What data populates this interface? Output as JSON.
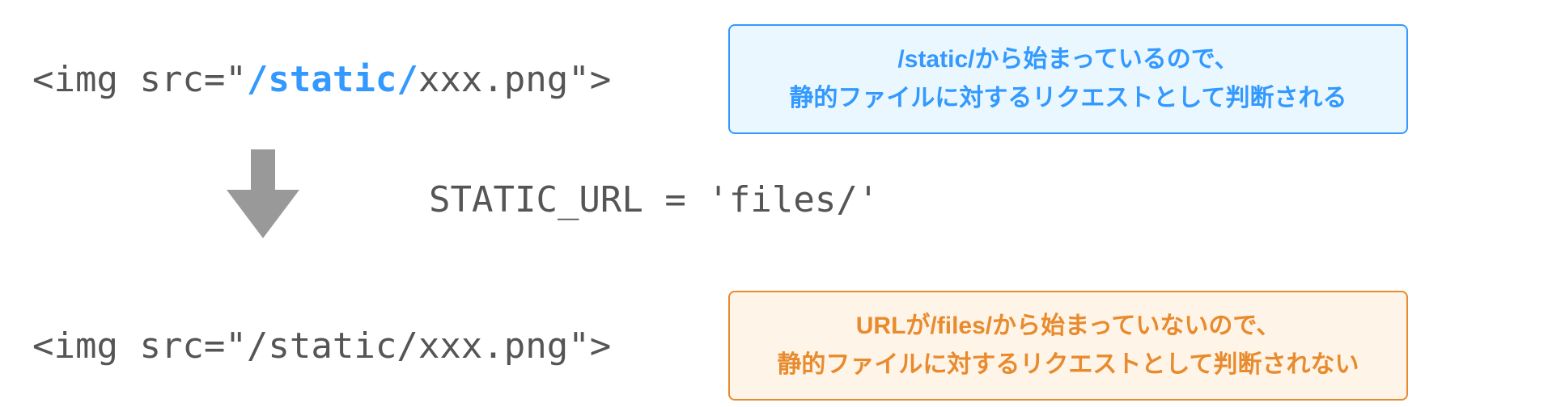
{
  "top": {
    "code_prefix": "<img src=\"",
    "code_highlight": "/static/",
    "code_suffix": "xxx.png\">",
    "box_line1_highlight": "/static/",
    "box_line1_rest": "から始まっているので、",
    "box_line2": "静的ファイルに対するリクエストとして判断される"
  },
  "middle": {
    "config": "STATIC_URL = 'files/'"
  },
  "bottom": {
    "code": "<img src=\"/static/xxx.png\">",
    "box_line1_pre": "URLが",
    "box_line1_highlight": "/files/",
    "box_line1_post": "から始まっていないので、",
    "box_line2": "静的ファイルに対するリクエストとして判断されない"
  }
}
